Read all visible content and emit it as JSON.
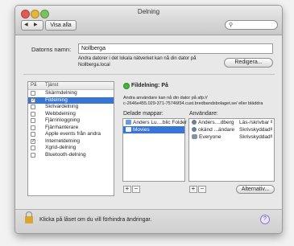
{
  "window": {
    "title": "Delning"
  },
  "toolbar": {
    "back": "◀",
    "forward": "▶",
    "show_all": "Visa alla",
    "search_placeholder": ""
  },
  "computer": {
    "name_label": "Datorns namn:",
    "name_value": "Nollberga",
    "desc_line1": "Andra datorer i det lokala nätverket kan nå din dator på",
    "desc_line2": "Nollberga.local",
    "edit_button": "Redigera..."
  },
  "services": {
    "col_on": "På",
    "col_service": "Tjänst",
    "items": [
      {
        "name": "Skärmdelning",
        "on": false,
        "selected": false
      },
      {
        "name": "Fildelning",
        "on": true,
        "selected": true
      },
      {
        "name": "Skrivardelning",
        "on": false,
        "selected": false
      },
      {
        "name": "Webbdelning",
        "on": false,
        "selected": false
      },
      {
        "name": "Fjärrinloggning",
        "on": false,
        "selected": false
      },
      {
        "name": "Fjärrhanterare",
        "on": false,
        "selected": false
      },
      {
        "name": "Apple events från andra",
        "on": false,
        "selected": false
      },
      {
        "name": "Internetdelning",
        "on": true,
        "selected": false
      },
      {
        "name": "Xgrid-delning",
        "on": false,
        "selected": false
      },
      {
        "name": "Bluetooth-delning",
        "on": false,
        "selected": false
      }
    ]
  },
  "detail": {
    "status": "Fildelning: På",
    "info_line1": "Andra användare kan nå din dator på afp://",
    "info_line2": "c-2646e455.029-371-75746f34.cust.bredbandsbolaget.se/ eller bläddra",
    "shared_folders_label": "Delade mappar:",
    "users_label": "Användare:",
    "shared_folders": [
      {
        "name": "Anders Lu....blic Folder",
        "selected": false
      },
      {
        "name": "Movies",
        "selected": true
      }
    ],
    "users": [
      {
        "name": "Anders....dberg",
        "perm": "Läs-/skrivbar"
      },
      {
        "name": "okänd ...ändare",
        "perm": "Skrivskyddad"
      },
      {
        "name": "Everyone",
        "perm": "Skrivskyddad"
      }
    ],
    "add": "+",
    "remove": "−",
    "options_button": "Alternativ..."
  },
  "footer": {
    "lock_text": "Klicka på låset om du vill förhindra ändringar.",
    "help": "?"
  }
}
